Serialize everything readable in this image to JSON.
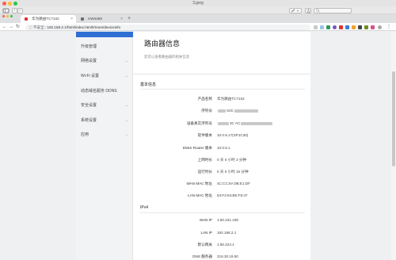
{
  "window": {
    "title": "3.jpeg"
  },
  "toolbar": {
    "sidebar_icon": "sidebar-icon",
    "back": "‹",
    "forward": "›",
    "edit_icon": "pen-icon",
    "share_icon": "share-icon",
    "search_icon": "search-icon"
  },
  "tabs": [
    {
      "label": "华为路由TC7102",
      "active": true,
      "favicon_color": "#e0312b"
    },
    {
      "label": "HW4469",
      "active": false,
      "favicon_color": "#6c6c6c"
    }
  ],
  "addressbar": {
    "security_label": "不安全",
    "url": "192.168.2.1/html/index.html#/more/deviceinfo"
  },
  "nav": {
    "items": [
      {
        "label": "升级管理",
        "has_chevron": false
      },
      {
        "label": "网络设置",
        "has_chevron": true
      },
      {
        "label": "Wi-Fi 设置",
        "has_chevron": true
      },
      {
        "label": "动态域名服务 DDNS",
        "has_chevron": false
      },
      {
        "label": "安全设置",
        "has_chevron": true
      },
      {
        "label": "系统设置",
        "has_chevron": true
      },
      {
        "label": "应用",
        "has_chevron": true
      }
    ]
  },
  "main": {
    "title": "路由器信息",
    "subtitle": "您可以查看路由器的相关信息",
    "basic_section": "基本信息",
    "basic_rows": [
      {
        "label": "产品名称",
        "value": "华为路由TC7102"
      },
      {
        "label": "序列号",
        "value": "S2C"
      },
      {
        "label": "设备真实序列号",
        "value": "3C AC"
      },
      {
        "label": "软件版本",
        "value": "10.0.5.17(SP1C30)"
      },
      {
        "label": "EMUI Router 版本",
        "value": "10.0.5.1"
      },
      {
        "label": "上网时长",
        "value": "0 天 0 小时 3 分钟"
      },
      {
        "label": "运行时长",
        "value": "0 天 0 小时 15 分钟"
      },
      {
        "label": "WAN MAC 地址",
        "value": "4C:CC:6A:0B:E1:DF"
      },
      {
        "label": "LAN MAC 地址",
        "value": "54:F2:64:BE:F6:47"
      }
    ],
    "ipv4_section": "IPv4",
    "ipv4_rows": [
      {
        "label": "WAN IP",
        "value": "1.80.231.108"
      },
      {
        "label": "LAN IP",
        "value": "192.168.2.1"
      },
      {
        "label": "默认网关",
        "value": "1.80.224.1"
      },
      {
        "label": "DNS 服务器",
        "value": "218.30.19.50"
      }
    ]
  },
  "colors": {
    "accent": "#2f6fd4",
    "close": "#fe5f57",
    "minimize": "#febc2e",
    "maximize": "#28c840"
  }
}
